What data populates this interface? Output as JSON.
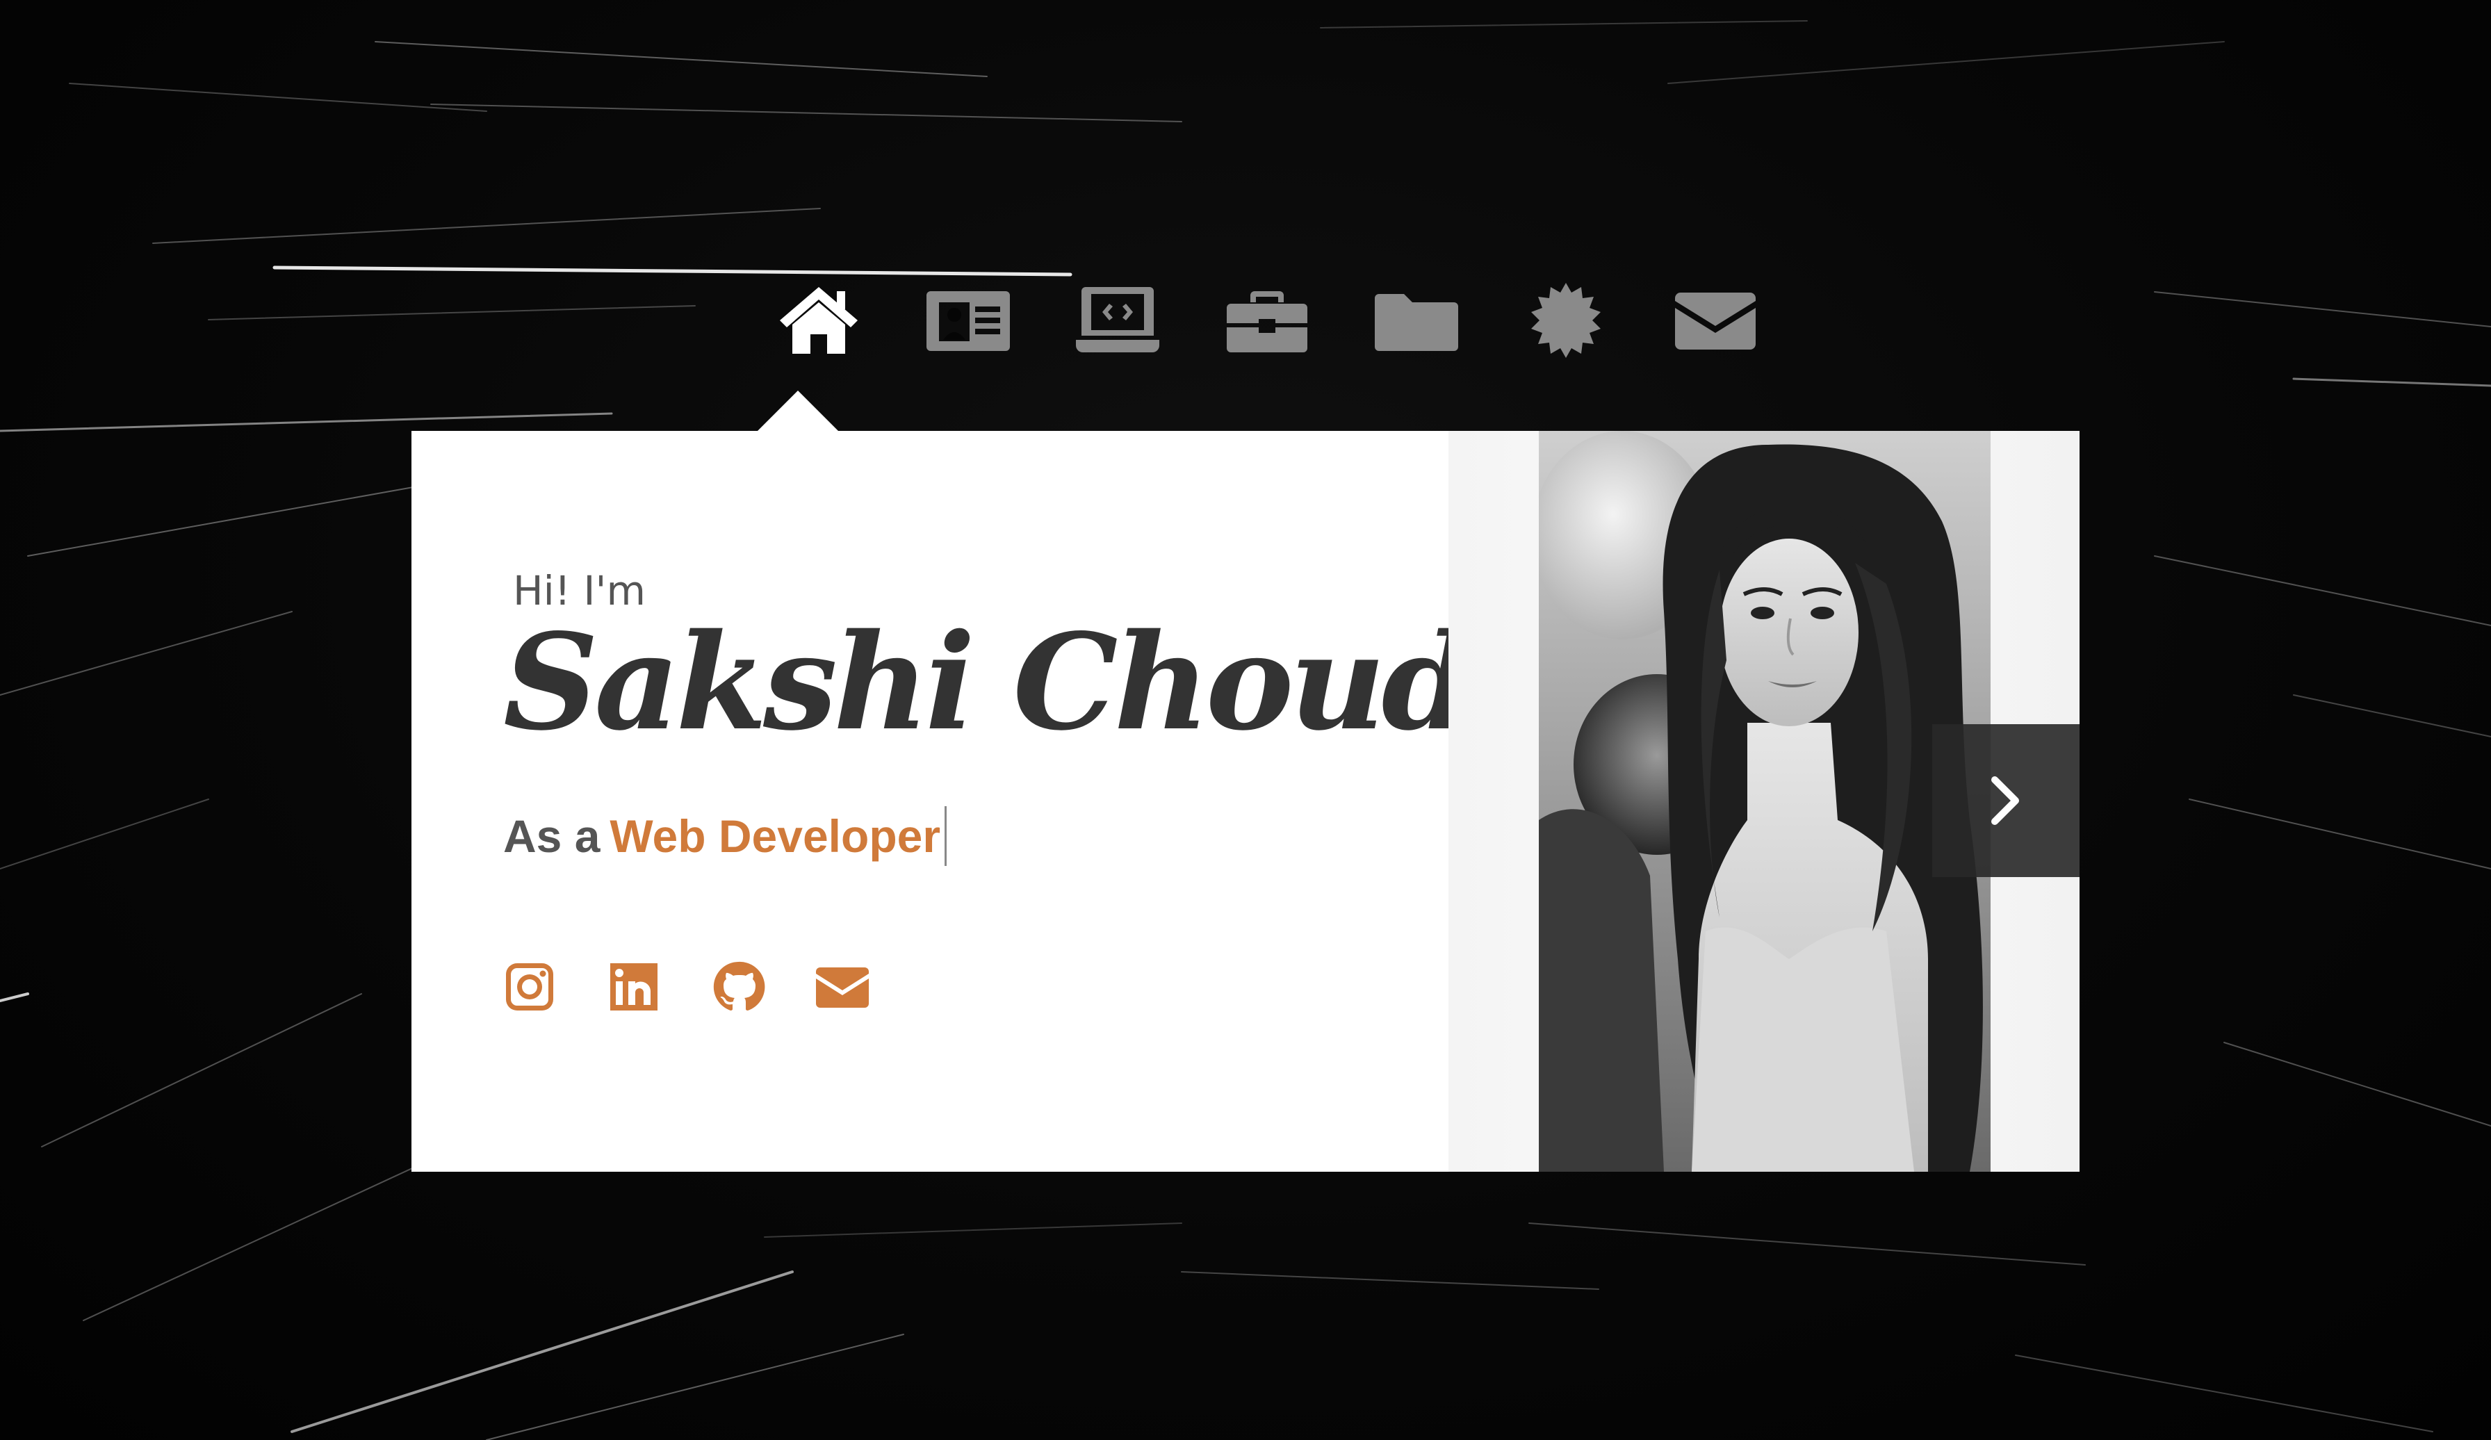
{
  "nav": {
    "items": [
      {
        "label": "Home",
        "icon": "home-icon",
        "active": true
      },
      {
        "label": "About",
        "icon": "id-card-icon",
        "active": false
      },
      {
        "label": "Skills",
        "icon": "laptop-code-icon",
        "active": false
      },
      {
        "label": "Experience",
        "icon": "briefcase-icon",
        "active": false
      },
      {
        "label": "Projects",
        "icon": "folder-icon",
        "active": false
      },
      {
        "label": "Certificates",
        "icon": "badge-icon",
        "active": false
      },
      {
        "label": "Contact",
        "icon": "envelope-icon",
        "active": false
      }
    ],
    "active_color": "#ffffff",
    "inactive_color": "#8a8a8a"
  },
  "hero": {
    "greeting": "Hi! I'm",
    "name": "Sakshi Choudhary",
    "role_prefix": "As a",
    "role_value": "Web Developer"
  },
  "socials": [
    {
      "name": "Instagram",
      "icon": "instagram-icon"
    },
    {
      "name": "LinkedIn",
      "icon": "linkedin-icon"
    },
    {
      "name": "GitHub",
      "icon": "github-icon"
    },
    {
      "name": "Email",
      "icon": "envelope-icon"
    }
  ],
  "colors": {
    "accent": "#d07a3a",
    "card_bg": "#ffffff",
    "page_bg": "#050505",
    "text_dark": "#333333",
    "text_muted": "#555555"
  },
  "carousel": {
    "next_icon": "chevron-right-icon"
  }
}
